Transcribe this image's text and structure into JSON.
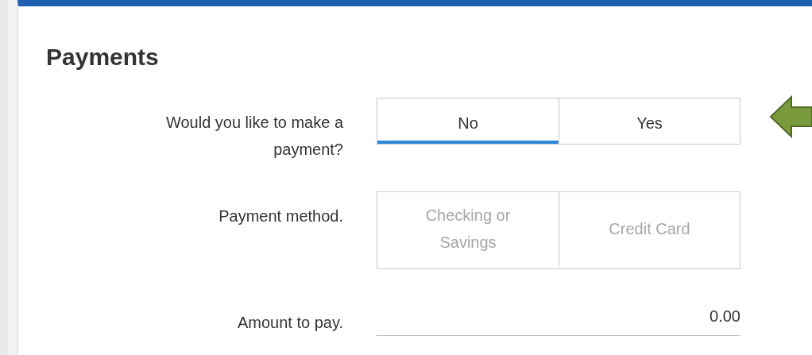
{
  "title": "Payments",
  "fields": [
    {
      "kind": "toggle",
      "label": "Would you like to make a payment?",
      "disabled": false,
      "options": [
        {
          "label": "No",
          "selected": true
        },
        {
          "label": "Yes",
          "selected": false
        }
      ]
    },
    {
      "kind": "toggle",
      "label": "Payment method.",
      "disabled": true,
      "options": [
        {
          "label": "Checking or Savings",
          "selected": false
        },
        {
          "label": "Credit Card",
          "selected": false
        }
      ]
    },
    {
      "kind": "amount",
      "label": "Amount to pay.",
      "value": "0.00"
    }
  ]
}
